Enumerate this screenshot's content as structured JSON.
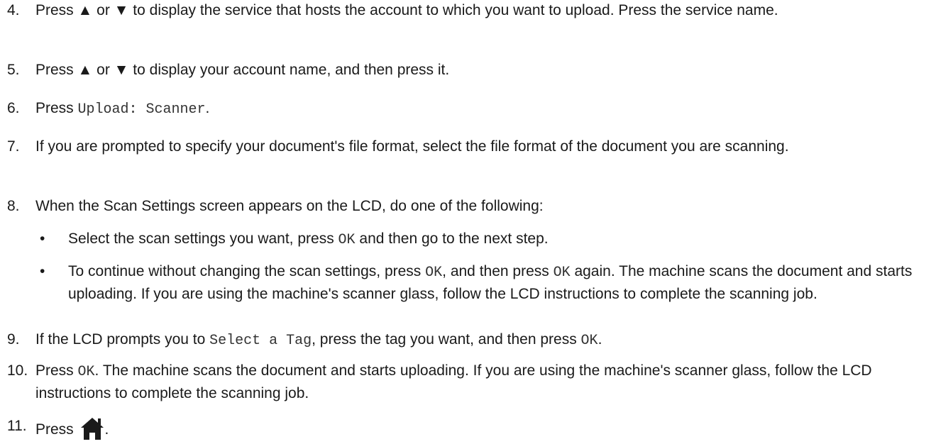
{
  "steps": [
    {
      "num": "4.",
      "parts": [
        "Press ",
        "▲",
        " or ",
        "▼",
        " to display the service that hosts the account to which you want to upload. Press the service name."
      ]
    },
    {
      "num": "5.",
      "parts": [
        "Press ",
        "▲",
        " or ",
        "▼",
        " to display your account name, and then press it."
      ]
    },
    {
      "num": "6.",
      "pre": "Press ",
      "code": "Upload: Scanner",
      "post": "."
    },
    {
      "num": "7.",
      "text": "If you are prompted to specify your document's file format, select the file format of the document you are scanning."
    },
    {
      "num": "8.",
      "text": "When the Scan Settings screen appears on the LCD, do one of the following:",
      "bullets": [
        {
          "dot": "•",
          "pre": "Select the scan settings you want, press ",
          "code": "OK",
          "post": " and then go to the next step."
        },
        {
          "dot": "•",
          "pre": "To continue without changing the scan settings, press ",
          "code1": "OK",
          "mid": ", and then press ",
          "code2": "OK",
          "post": " again. The machine scans the document and starts uploading. If you are using the machine's scanner glass, follow the LCD instructions to complete the scanning job."
        }
      ]
    },
    {
      "num": "9.",
      "pre": "If the LCD prompts you to ",
      "code1": "Select a Tag",
      "mid": ", press the tag you want, and then press ",
      "code2": "OK",
      "post": "."
    },
    {
      "num": "10.",
      "pre": "Press ",
      "code": "OK",
      "post": ". The machine scans the document and starts uploading. If you are using the machine's scanner glass, follow the LCD instructions to complete the scanning job."
    },
    {
      "num": "11.",
      "pre": "Press ",
      "icon": "home-icon",
      "post": "."
    }
  ]
}
